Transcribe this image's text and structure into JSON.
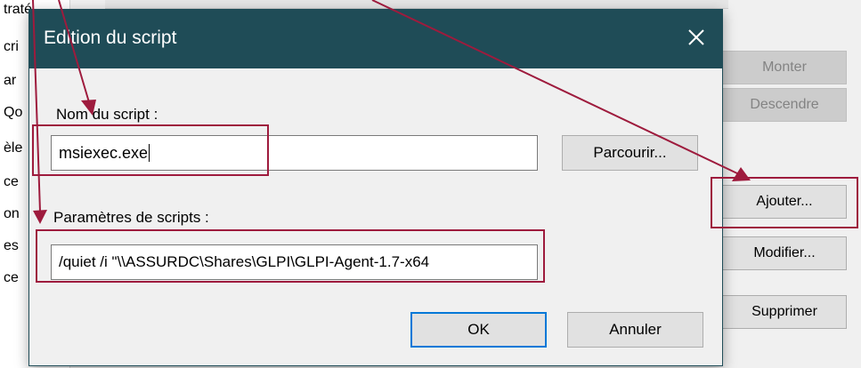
{
  "background": {
    "left_list_fragments": [
      "traté",
      "cri",
      "ar",
      "Qo",
      "èle",
      "ce",
      "on",
      "es",
      "ce"
    ],
    "buttons": {
      "up": "Monter",
      "down": "Descendre",
      "add": "Ajouter...",
      "edit": "Modifier...",
      "delete": "Supprimer"
    }
  },
  "dialog": {
    "title": "Edition du script",
    "script_name_label": "Nom du script :",
    "script_name_value": "msiexec.exe",
    "browse_label": "Parcourir...",
    "params_label": "Paramètres de scripts :",
    "params_value": "/quiet /i \"\\\\ASSURDC\\Shares\\GLPI\\GLPI-Agent-1.7-x64",
    "ok_label": "OK",
    "cancel_label": "Annuler"
  },
  "colors": {
    "titlebar": "#1f4c57",
    "annotation": "#9e1b3d",
    "focus": "#0078d7"
  },
  "icons": {
    "close": "close-icon",
    "annotation_arrows": "arrow-icon"
  }
}
